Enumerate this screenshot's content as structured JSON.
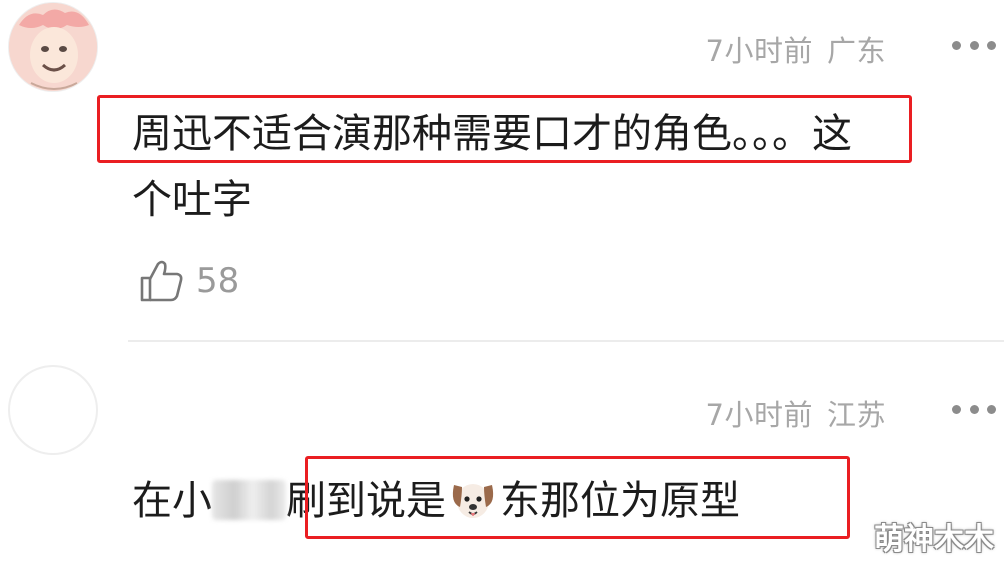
{
  "comments": [
    {
      "time": "7小时前",
      "location": "广东",
      "text_line1": "周迅不适合演那种需要口才的角色。。。这",
      "text_line2": "个吐字",
      "likes": "58"
    },
    {
      "time": "7小时前",
      "location": "江苏",
      "text_prefix": "在小",
      "text_suffix_a": "刷到说是",
      "text_suffix_b": "东那位为原型"
    }
  ],
  "watermark": "萌神木木",
  "colors": {
    "highlight": "#ea1e22",
    "meta": "#a7a7a7",
    "text": "#1c1c1c"
  },
  "icons": [
    "avatar-emoji",
    "more-dots-icon",
    "thumbs-up-icon",
    "dog-face-emoji"
  ]
}
